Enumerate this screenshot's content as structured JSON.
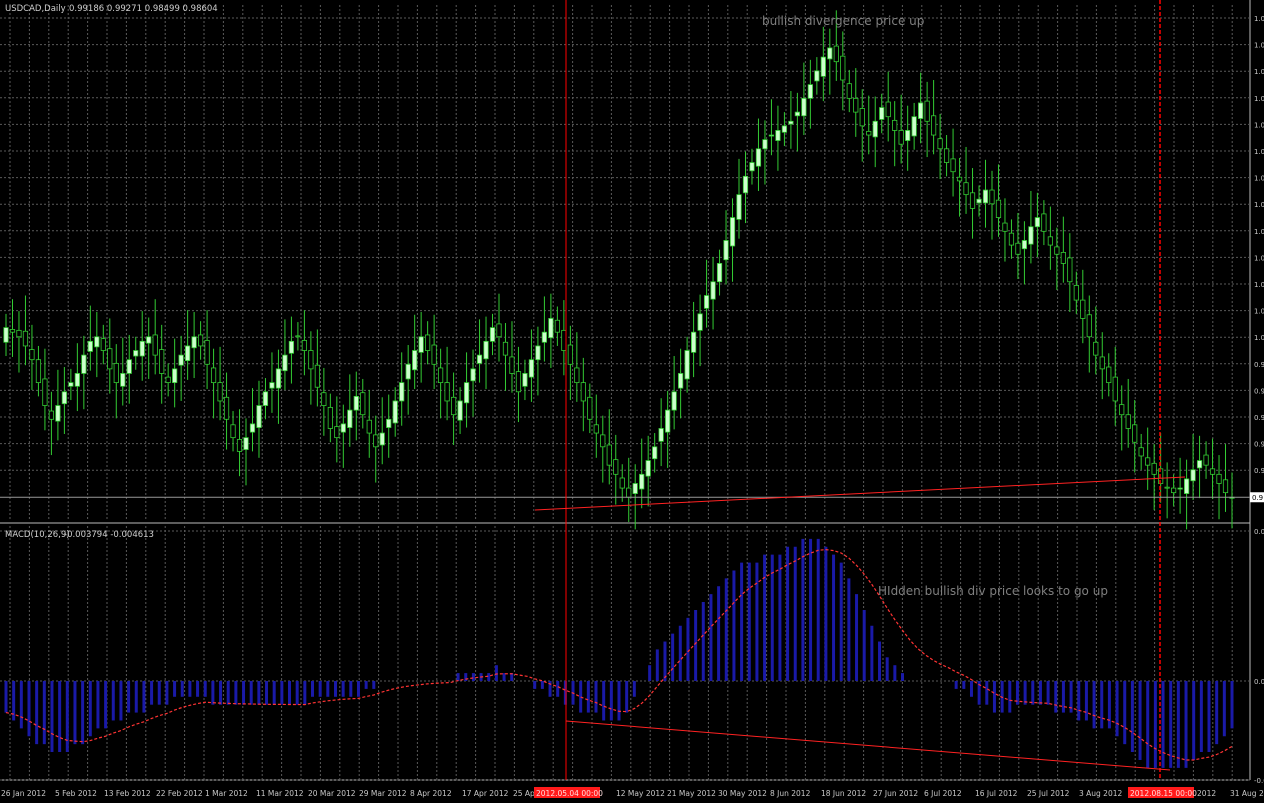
{
  "header": {
    "symbol_title": "USDCAD,Daily",
    "ohlc": "0.99186 0.99271 0.98499 0.98604"
  },
  "annotations": {
    "price_note": "bullish divergence price up",
    "macd_note": "HIdden bullish div price looks to go up"
  },
  "macd": {
    "title": "MACD(10,26,9)",
    "values": "-0.003794 -0.004613",
    "y_labels": [
      "0.0",
      "0.0",
      "-0.0"
    ]
  },
  "price_axis": {
    "labels": [
      "1.0",
      "1.0",
      "1.0",
      "1.0",
      "1.0",
      "1.0",
      "1.0",
      "1.0",
      "1.0",
      "1.0",
      "1.0",
      "1.0",
      "1.0",
      "0.9",
      "0.9",
      "0.9",
      "0.9",
      "0.9"
    ],
    "current_label": "0.9"
  },
  "date_axis": {
    "labels": [
      "26 Jan 2012",
      "5 Feb 2012",
      "13 Feb 2012",
      "22 Feb 2012",
      "1 Mar 2012",
      "11 Mar 2012",
      "20 Mar 2012",
      "29 Mar 2012",
      "8 Apr 2012",
      "17 Apr 2012",
      "25 Ap",
      "12 May 2012",
      "21 May 2012",
      "30 May 2012",
      "8 Jun 2012",
      "18 Jun 2012",
      "27 Jun 2012",
      "6 Jul 2012",
      "16 Jul 2012",
      "25 Jul 2012",
      "3 Aug 2012",
      "Aug 2012",
      "31 Aug 20"
    ],
    "marker_labels": [
      "2012.05.04 00:00",
      "2012.08.15 00:00"
    ]
  },
  "colors": {
    "background": "#000000",
    "grid": "#5a5a5a",
    "bull_body": "#ccffcc",
    "wick": "#33cc33",
    "macd_hist": "#1a1aa8",
    "signal": "#ff3333",
    "trendline": "#ff2222",
    "marker": "#ff0000"
  },
  "chart_data": [
    {
      "type": "candlestick",
      "title": "USDCAD,Daily",
      "close": [
        1.002,
        1.001,
        1.0,
        0.998,
        0.995,
        0.99,
        0.985,
        0.982,
        0.985,
        0.988,
        0.99,
        0.992,
        0.996,
        0.999,
        1.0,
        0.997,
        0.993,
        0.99,
        0.992,
        0.995,
        0.997,
        0.999,
        1.0,
        0.996,
        0.992,
        0.99,
        0.993,
        0.996,
        0.998,
        1.0,
        0.998,
        0.994,
        0.99,
        0.986,
        0.982,
        0.978,
        0.975,
        0.978,
        0.981,
        0.985,
        0.988,
        0.99,
        0.993,
        0.996,
        0.999,
        1.0,
        0.997,
        0.993,
        0.989,
        0.985,
        0.98,
        0.978,
        0.981,
        0.984,
        0.987,
        0.983,
        0.979,
        0.976,
        0.979,
        0.982,
        0.986,
        0.99,
        0.994,
        0.997,
        1.0,
        0.997,
        0.994,
        0.99,
        0.986,
        0.983,
        0.986,
        0.99,
        0.993,
        0.996,
        0.999,
        1.002,
        1.0,
        0.996,
        0.992,
        0.988,
        0.992,
        0.995,
        0.998,
        1.001,
        1.004,
        1.001,
        0.997,
        0.994,
        0.99,
        0.986,
        0.982,
        0.979,
        0.976,
        0.972,
        0.97,
        0.967,
        0.965,
        0.968,
        0.97,
        0.973,
        0.976,
        0.98,
        0.984,
        0.988,
        0.992,
        0.997,
        1.001,
        1.005,
        1.009,
        1.012,
        1.016,
        1.021,
        1.026,
        1.031,
        1.035,
        1.038,
        1.041,
        1.043,
        1.044,
        1.045,
        1.046,
        1.047,
        1.049,
        1.052,
        1.055,
        1.058,
        1.061,
        1.063,
        1.06,
        1.056,
        1.052,
        1.049,
        1.046,
        1.044,
        1.047,
        1.05,
        1.048,
        1.045,
        1.042,
        1.045,
        1.048,
        1.051,
        1.047,
        1.044,
        1.041,
        1.038,
        1.036,
        1.034,
        1.031,
        1.028,
        1.03,
        1.032,
        1.029,
        1.026,
        1.023,
        1.02,
        1.018,
        1.021,
        1.024,
        1.026,
        1.023,
        1.02,
        1.018,
        1.016,
        1.012,
        1.008,
        1.004,
        1.0,
        0.996,
        0.993,
        0.99,
        0.986,
        0.983,
        0.98,
        0.977,
        0.974,
        0.972,
        0.97,
        0.968,
        0.967,
        0.966,
        0.967,
        0.969,
        0.971,
        0.973,
        0.972,
        0.97,
        0.968,
        0.966,
        0.965
      ],
      "annotations": [
        "bullish divergence price up"
      ]
    },
    {
      "type": "bar",
      "title": "MACD(10,26,9)",
      "series": [
        {
          "name": "MACD",
          "values": [
            -0.004,
            -0.005,
            -0.006,
            -0.007,
            -0.008,
            -0.008,
            -0.009,
            -0.009,
            -0.009,
            -0.008,
            -0.008,
            -0.007,
            -0.006,
            -0.006,
            -0.005,
            -0.005,
            -0.004,
            -0.004,
            -0.004,
            -0.003,
            -0.003,
            -0.003,
            -0.002,
            -0.002,
            -0.002,
            -0.002,
            -0.002,
            -0.003,
            -0.003,
            -0.003,
            -0.003,
            -0.003,
            -0.003,
            -0.003,
            -0.003,
            -0.003,
            -0.003,
            -0.003,
            -0.003,
            -0.003,
            -0.002,
            -0.002,
            -0.002,
            -0.002,
            -0.002,
            -0.002,
            -0.002,
            -0.001,
            -0.001,
            0.0,
            0.0,
            0.0,
            0.0,
            0.0,
            0.0,
            0.0,
            0.0,
            0.0,
            0.0,
            0.001,
            0.001,
            0.001,
            0.001,
            0.001,
            0.002,
            0.001,
            0.001,
            0.0,
            0.0,
            -0.001,
            -0.001,
            -0.002,
            -0.002,
            -0.003,
            -0.003,
            -0.004,
            -0.004,
            -0.004,
            -0.005,
            -0.005,
            -0.005,
            -0.004,
            -0.002,
            0.0,
            0.002,
            0.004,
            0.005,
            0.006,
            0.007,
            0.008,
            0.009,
            0.01,
            0.011,
            0.012,
            0.013,
            0.014,
            0.015,
            0.015,
            0.015,
            0.016,
            0.016,
            0.016,
            0.017,
            0.017,
            0.018,
            0.018,
            0.018,
            0.017,
            0.016,
            0.015,
            0.013,
            0.011,
            0.009,
            0.007,
            0.005,
            0.003,
            0.002,
            0.001,
            0.0,
            0.0,
            0.0,
            0.0,
            0.0,
            0.0,
            -0.001,
            -0.001,
            -0.002,
            -0.003,
            -0.003,
            -0.004,
            -0.004,
            -0.004,
            -0.003,
            -0.003,
            -0.003,
            -0.003,
            -0.003,
            -0.004,
            -0.004,
            -0.004,
            -0.005,
            -0.005,
            -0.006,
            -0.006,
            -0.006,
            -0.007,
            -0.008,
            -0.009,
            -0.01,
            -0.011,
            -0.011,
            -0.011,
            -0.011,
            -0.011,
            -0.011,
            -0.01,
            -0.009,
            -0.009,
            -0.008,
            -0.007,
            -0.006
          ]
        }
      ],
      "annotations": [
        "HIdden bullish div price looks to go up"
      ]
    }
  ]
}
